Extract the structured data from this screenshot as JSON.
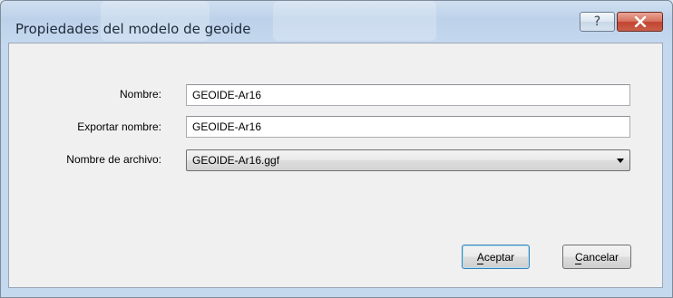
{
  "dialog": {
    "title": "Propiedades del modelo de geoide",
    "help_glyph": "?",
    "close_icon": "close-icon"
  },
  "form": {
    "nombre_label": "Nombre:",
    "nombre_value": "GEOIDE-Ar16",
    "exportar_label": "Exportar nombre:",
    "exportar_value": "GEOIDE-Ar16",
    "archivo_label": "Nombre de archivo:",
    "archivo_value": "GEOIDE-Ar16.ggf"
  },
  "buttons": {
    "accept_label": "Aceptar",
    "cancel_label": "Cancelar"
  },
  "colors": {
    "close_button": "#c24431",
    "default_button_border": "#3c7fb1",
    "dialog_face": "#f0f0f0"
  }
}
